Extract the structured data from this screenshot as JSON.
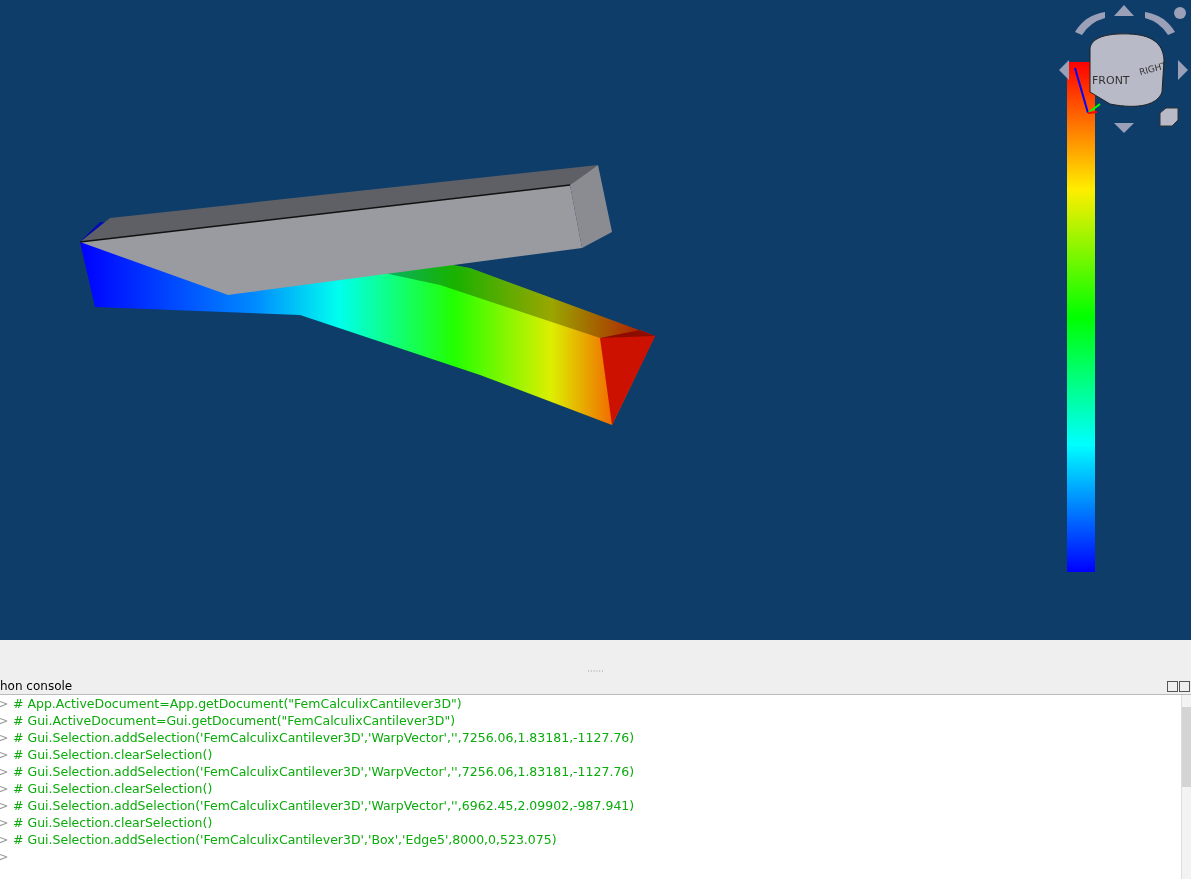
{
  "viewport": {
    "nav_cube": {
      "faces": [
        "FRONT",
        "RIGHT"
      ]
    }
  },
  "console": {
    "title": "hon console",
    "lines": [
      {
        "prompt": ">",
        "text": "# App.ActiveDocument=App.getDocument(\"FemCalculixCantilever3D\")"
      },
      {
        "prompt": ">",
        "text": "# Gui.ActiveDocument=Gui.getDocument(\"FemCalculixCantilever3D\")"
      },
      {
        "prompt": ">",
        "text": "# Gui.Selection.addSelection('FemCalculixCantilever3D','WarpVector','',7256.06,1.83181,-1127.76)"
      },
      {
        "prompt": ">",
        "text": "# Gui.Selection.clearSelection()"
      },
      {
        "prompt": ">",
        "text": "# Gui.Selection.addSelection('FemCalculixCantilever3D','WarpVector','',7256.06,1.83181,-1127.76)"
      },
      {
        "prompt": ">",
        "text": "# Gui.Selection.clearSelection()"
      },
      {
        "prompt": ">",
        "text": "# Gui.Selection.addSelection('FemCalculixCantilever3D','WarpVector','',6962.45,2.09902,-987.941)"
      },
      {
        "prompt": ">",
        "text": "# Gui.Selection.clearSelection()"
      },
      {
        "prompt": ">",
        "text": "# Gui.Selection.addSelection('FemCalculixCantilever3D','Box','Edge5',8000,0,523.075)"
      },
      {
        "prompt": ">"
      }
    ]
  }
}
